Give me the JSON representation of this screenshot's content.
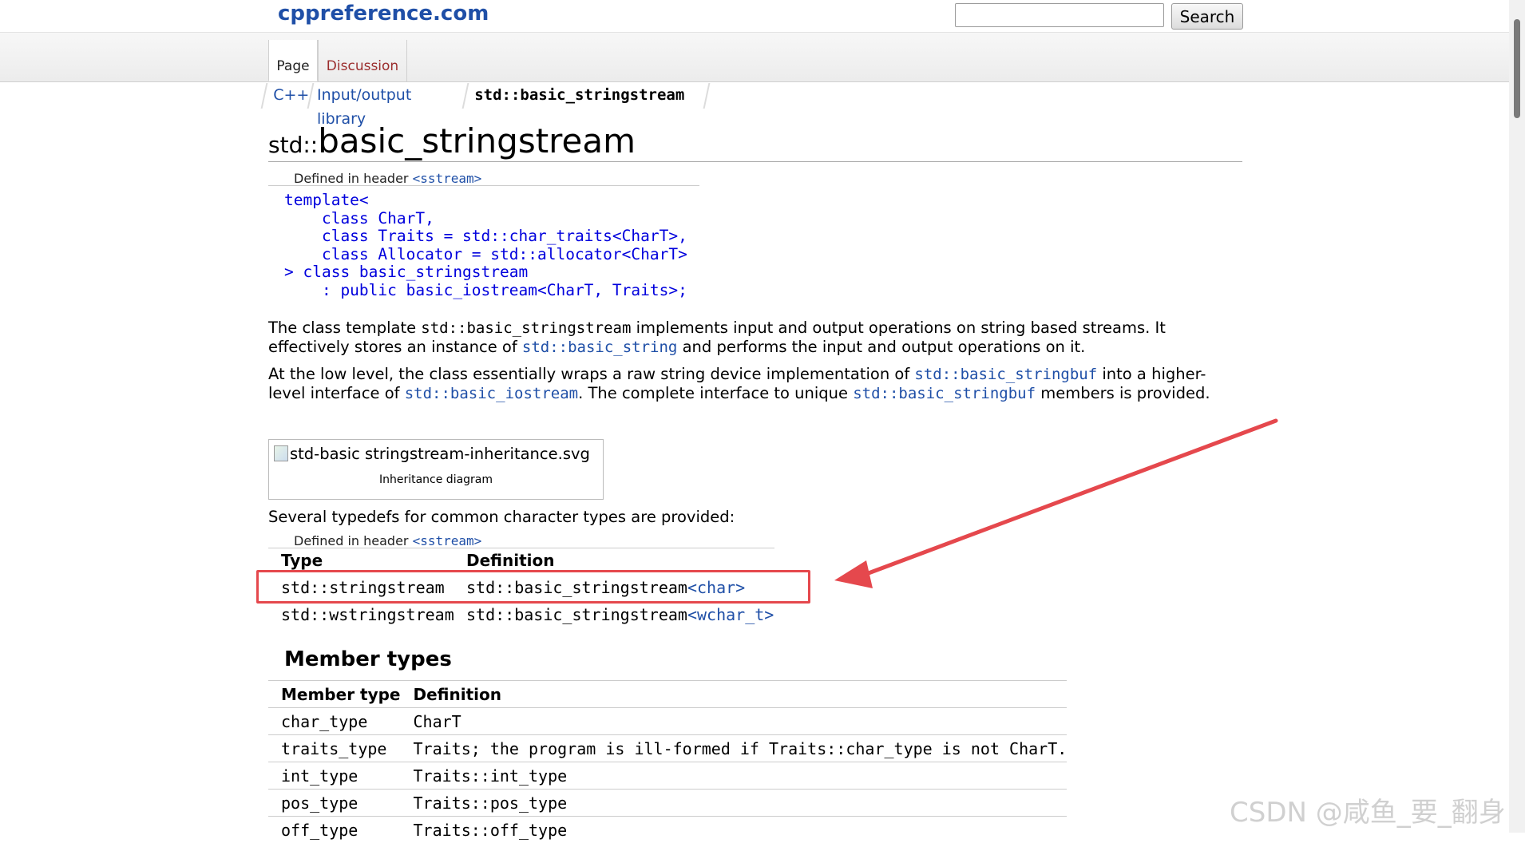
{
  "header": {
    "site_title": "cppreference.com",
    "search_placeholder": "",
    "search_button": "Search",
    "tabs": [
      {
        "label": "Page"
      },
      {
        "label": "Discussion"
      }
    ]
  },
  "breadcrumb": [
    "C++",
    "Input/output library",
    "std::basic_stringstream"
  ],
  "title": {
    "prefix": "std::",
    "main": "basic_stringstream"
  },
  "declaration": {
    "defined_in_label": "Defined in header ",
    "header": "<sstream>",
    "lines": [
      "template<",
      "    class CharT,",
      "    class Traits = std::char_traits<CharT>,",
      "    class Allocator = std::allocator<CharT>",
      "> class basic_stringstream",
      "    : public basic_iostream<CharT, Traits>;"
    ]
  },
  "paragraphs": {
    "p1": {
      "a": "The class template ",
      "b": "std::basic_stringstream",
      "c": " implements input and output operations on string based streams. It effectively stores an instance of ",
      "d": "std::basic_string",
      "e": " and performs the input and output operations on it."
    },
    "p2": {
      "a": "At the low level, the class essentially wraps a raw string device implementation of ",
      "b": "std::basic_stringbuf",
      "c": " into a higher-level interface of ",
      "d": "std::basic_iostream",
      "e": ". The complete interface to unique ",
      "f": "std::basic_stringbuf",
      "g": " members is provided."
    },
    "p3": "Several typedefs for common character types are provided:"
  },
  "diagram": {
    "alt": "std-basic stringstream-inheritance.svg",
    "caption": "Inheritance diagram"
  },
  "typedefs": {
    "defined_in_label": "Defined in header ",
    "header": "<sstream>",
    "col_type": "Type",
    "col_def": "Definition",
    "rows": [
      {
        "type": "std::stringstream",
        "def_base": "std::basic_stringstream",
        "def_arg": "<char>"
      },
      {
        "type": "std::wstringstream",
        "def_base": "std::basic_stringstream",
        "def_arg": "<wchar_t>"
      }
    ]
  },
  "member_types": {
    "heading": "Member types",
    "col_type": "Member type",
    "col_def": "Definition",
    "rows": [
      {
        "type": "char_type",
        "def": "CharT"
      },
      {
        "type": "traits_type",
        "def": "Traits; the program is ill-formed if Traits::char_type is not CharT."
      },
      {
        "type": "int_type",
        "def": "Traits::int_type"
      },
      {
        "type": "pos_type",
        "def": "Traits::pos_type"
      },
      {
        "type": "off_type",
        "def": "Traits::off_type"
      }
    ]
  },
  "annotation": {
    "color": "#e5484d"
  },
  "watermark": "CSDN @咸鱼_要_翻身"
}
